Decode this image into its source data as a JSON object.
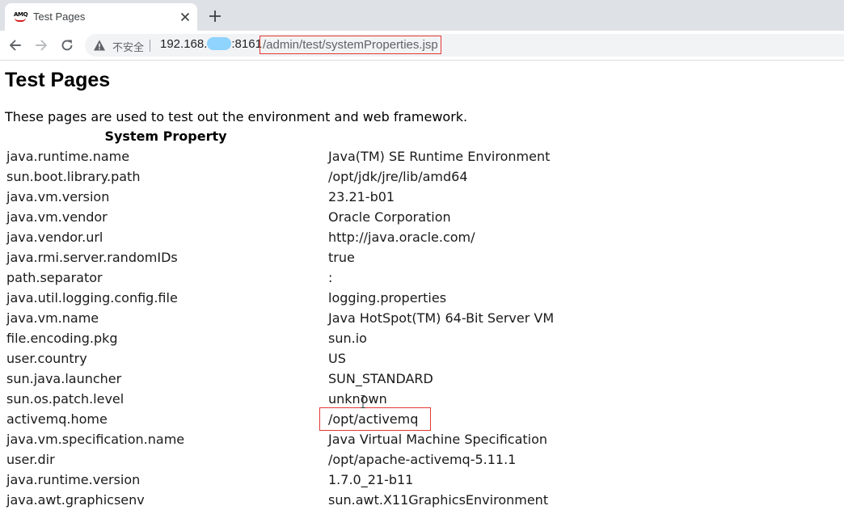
{
  "browser": {
    "tab": {
      "title": "Test Pages",
      "favicon_text": "AMQ"
    },
    "address": {
      "insecure_label": "不安全",
      "host_prefix": "192.168.",
      "host_suffix": ":8161",
      "path": "/admin/test/systemProperties.jsp"
    },
    "icons": {
      "back": "back-arrow-icon",
      "forward": "forward-arrow-icon",
      "reload": "reload-icon",
      "warning": "warning-icon",
      "close": "close-icon",
      "new_tab": "plus-icon"
    }
  },
  "page": {
    "title": "Test Pages",
    "intro": "These pages are used to test out the environment and web framework.",
    "table": {
      "header_property": "System Property",
      "header_value": "",
      "rows": [
        {
          "key": "java.runtime.name",
          "value": "Java(TM) SE Runtime Environment"
        },
        {
          "key": "sun.boot.library.path",
          "value": "/opt/jdk/jre/lib/amd64"
        },
        {
          "key": "java.vm.version",
          "value": "23.21-b01"
        },
        {
          "key": "java.vm.vendor",
          "value": "Oracle Corporation"
        },
        {
          "key": "java.vendor.url",
          "value": "http://java.oracle.com/"
        },
        {
          "key": "java.rmi.server.randomIDs",
          "value": "true"
        },
        {
          "key": "path.separator",
          "value": ":"
        },
        {
          "key": "java.util.logging.config.file",
          "value": "logging.properties"
        },
        {
          "key": "java.vm.name",
          "value": "Java HotSpot(TM) 64-Bit Server VM"
        },
        {
          "key": "file.encoding.pkg",
          "value": "sun.io"
        },
        {
          "key": "user.country",
          "value": "US"
        },
        {
          "key": "sun.java.launcher",
          "value": "SUN_STANDARD"
        },
        {
          "key": "sun.os.patch.level",
          "value": "unknown"
        },
        {
          "key": "activemq.home",
          "value": "/opt/activemq"
        },
        {
          "key": "java.vm.specification.name",
          "value": "Java Virtual Machine Specification"
        },
        {
          "key": "user.dir",
          "value": "/opt/apache-activemq-5.11.1"
        },
        {
          "key": "java.runtime.version",
          "value": "1.7.0_21-b11"
        },
        {
          "key": "java.awt.graphicsenv",
          "value": "sun.awt.X11GraphicsEnvironment"
        }
      ]
    }
  },
  "colors": {
    "annotation_red": "#e53935",
    "tabstrip_bg": "#dee1e6",
    "omnibox_bg": "#f1f3f4",
    "redaction_blue": "#8fd3ff"
  }
}
